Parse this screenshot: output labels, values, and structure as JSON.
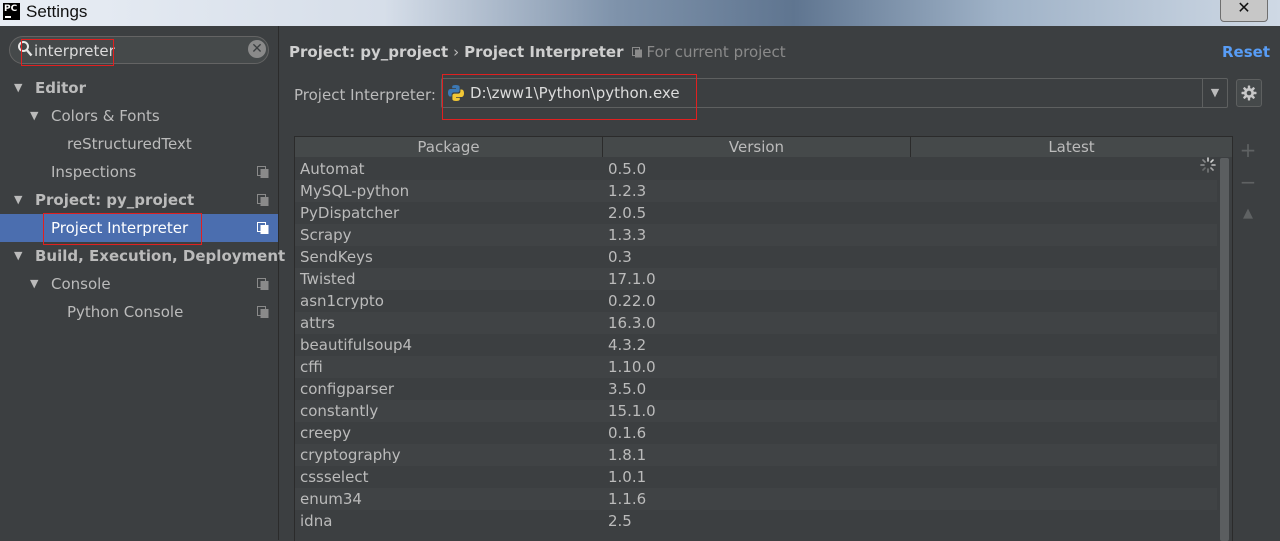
{
  "window": {
    "title": "Settings",
    "app_icon_text": "PC",
    "close_glyph": "✕"
  },
  "search": {
    "value": "interpreter",
    "clear_glyph": "✕"
  },
  "tree": [
    {
      "label": "Editor",
      "level": 0,
      "bold": true,
      "expanded": true,
      "project_icon": false,
      "selected": false
    },
    {
      "label": "Colors & Fonts",
      "level": 1,
      "bold": false,
      "expanded": true,
      "project_icon": false,
      "selected": false
    },
    {
      "label": "reStructuredText",
      "level": 2,
      "bold": false,
      "expanded": null,
      "project_icon": false,
      "selected": false
    },
    {
      "label": "Inspections",
      "level": 1,
      "bold": false,
      "expanded": null,
      "project_icon": true,
      "selected": false
    },
    {
      "label": "Project: py_project",
      "level": 0,
      "bold": true,
      "expanded": true,
      "project_icon": true,
      "selected": false
    },
    {
      "label": "Project Interpreter",
      "level": 1,
      "bold": false,
      "expanded": null,
      "project_icon": true,
      "selected": true
    },
    {
      "label": "Build, Execution, Deployment",
      "level": 0,
      "bold": true,
      "expanded": true,
      "project_icon": false,
      "selected": false
    },
    {
      "label": "Console",
      "level": 1,
      "bold": false,
      "expanded": true,
      "project_icon": true,
      "selected": false
    },
    {
      "label": "Python Console",
      "level": 2,
      "bold": false,
      "expanded": null,
      "project_icon": true,
      "selected": false
    }
  ],
  "breadcrumb": {
    "parent": "Project: py_project",
    "separator": "›",
    "current": "Project Interpreter",
    "hint": "For current project"
  },
  "reset_label": "Reset",
  "interpreter": {
    "label": "Project Interpreter:",
    "value": "D:\\zww1\\Python\\python.exe",
    "dropdown_glyph": "▼"
  },
  "packages": {
    "columns": [
      "Package",
      "Version",
      "Latest"
    ],
    "rows": [
      {
        "name": "Automat",
        "version": "0.5.0",
        "latest": ""
      },
      {
        "name": "MySQL-python",
        "version": "1.2.3",
        "latest": ""
      },
      {
        "name": "PyDispatcher",
        "version": "2.0.5",
        "latest": ""
      },
      {
        "name": "Scrapy",
        "version": "1.3.3",
        "latest": ""
      },
      {
        "name": "SendKeys",
        "version": "0.3",
        "latest": ""
      },
      {
        "name": "Twisted",
        "version": "17.1.0",
        "latest": ""
      },
      {
        "name": "asn1crypto",
        "version": "0.22.0",
        "latest": ""
      },
      {
        "name": "attrs",
        "version": "16.3.0",
        "latest": ""
      },
      {
        "name": "beautifulsoup4",
        "version": "4.3.2",
        "latest": ""
      },
      {
        "name": "cffi",
        "version": "1.10.0",
        "latest": ""
      },
      {
        "name": "configparser",
        "version": "3.5.0",
        "latest": ""
      },
      {
        "name": "constantly",
        "version": "15.1.0",
        "latest": ""
      },
      {
        "name": "creepy",
        "version": "0.1.6",
        "latest": ""
      },
      {
        "name": "cryptography",
        "version": "1.8.1",
        "latest": ""
      },
      {
        "name": "cssselect",
        "version": "1.0.1",
        "latest": ""
      },
      {
        "name": "enum34",
        "version": "1.1.6",
        "latest": ""
      },
      {
        "name": "idna",
        "version": "2.5",
        "latest": ""
      }
    ]
  },
  "tools": {
    "add_glyph": "+",
    "remove_glyph": "−",
    "upgrade_glyph": "▲"
  },
  "colors": {
    "background": "#3c3f41",
    "selection": "#4b6eaf",
    "link": "#589df6",
    "highlight_box": "#e02020"
  }
}
